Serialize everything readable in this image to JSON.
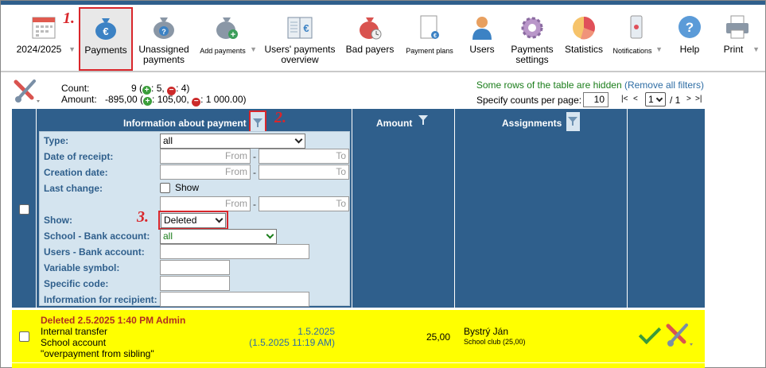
{
  "toolbar": {
    "year": "2024/2025",
    "items": [
      {
        "label": "Payments",
        "icon": "money-bag-euro-icon"
      },
      {
        "label": "Unassigned payments",
        "icon": "money-bag-question-icon"
      },
      {
        "label": "Add payments",
        "icon": "money-bag-add-icon"
      },
      {
        "label": "Users' payments overview",
        "icon": "ledger-euro-icon"
      },
      {
        "label": "Bad payers",
        "icon": "money-bag-clock-icon"
      },
      {
        "label": "Payment plans",
        "icon": "payment-plan-icon"
      },
      {
        "label": "Users",
        "icon": "user-icon"
      },
      {
        "label": "Payments settings",
        "icon": "gear-icon"
      },
      {
        "label": "Statistics",
        "icon": "pie-chart-icon"
      },
      {
        "label": "Notifications",
        "icon": "phone-icon"
      },
      {
        "label": "Help",
        "icon": "help-icon"
      },
      {
        "label": "Print",
        "icon": "printer-icon"
      }
    ]
  },
  "annotations": {
    "a1": "1.",
    "a2": "2.",
    "a3": "3."
  },
  "summary": {
    "count_label": "Count:",
    "count_value": "9",
    "count_plus": "5,",
    "count_minus": "4)",
    "amount_label": "Amount:",
    "amount_value": "-895,00",
    "amount_plus": "105,00,",
    "amount_minus": "1 000.00)",
    "hidden_text": "Some rows of the table are hidden",
    "remove_filters": "Remove all filters",
    "per_page_label": "Specify counts per page:",
    "per_page_value": "10",
    "page_current": "1",
    "page_total": "/ 1",
    "nav_first": "|<",
    "nav_prev": "<",
    "nav_next": ">",
    "nav_last": ">|"
  },
  "table": {
    "headers": {
      "info": "Information about payment",
      "amount": "Amount",
      "assignments": "Assignments"
    },
    "filters": {
      "type_label": "Type:",
      "type_value": "all",
      "receipt_label": "Date of receipt:",
      "creation_label": "Creation date:",
      "last_change_label": "Last change:",
      "show_checkbox_label": "Show",
      "from": "From",
      "to": "To",
      "show_label": "Show:",
      "show_value": "Deleted",
      "school_bank_label": "School - Bank account:",
      "school_bank_value": "all",
      "users_bank_label": "Users - Bank account:",
      "variable_label": "Variable symbol:",
      "specific_label": "Specific code:",
      "recipient_label": "Information for recipient:"
    },
    "row": {
      "deleted": "Deleted 2.5.2025 1:40 PM Admin",
      "type": "Internal transfer",
      "account": "School account",
      "note": "\"overpayment from sibling\"",
      "date": "1.5.2025",
      "datetime": "(1.5.2025 11:19 AM)",
      "amount": "25,00",
      "assign_name": "Bystrý Ján",
      "assign_detail": "School club (25,00)"
    }
  }
}
